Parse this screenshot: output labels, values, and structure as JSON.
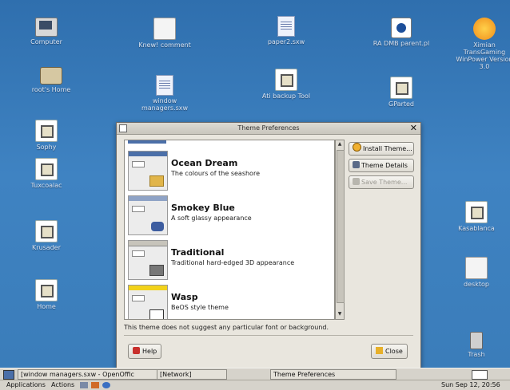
{
  "desktop": {
    "icons": [
      {
        "label": "Computer",
        "kind": "computer"
      },
      {
        "label": "root's Home",
        "kind": "folder"
      },
      {
        "label": "Knew! comment",
        "kind": "blank"
      },
      {
        "label": "window managers.sxw",
        "kind": "page"
      },
      {
        "label": "paper2.sxw",
        "kind": "page"
      },
      {
        "label": "Ati backup Tool",
        "kind": "doc"
      },
      {
        "label": "RA DMB parent.pl",
        "kind": "disc"
      },
      {
        "label": "GParted",
        "kind": "doc"
      },
      {
        "label": "Ximian TransGaming WinPower Version 3.0",
        "kind": "logo"
      },
      {
        "label": "Sophy",
        "kind": "doc"
      },
      {
        "label": "Tuxcoalac",
        "kind": "doc"
      },
      {
        "label": "Krusader",
        "kind": "doc"
      },
      {
        "label": "Home",
        "kind": "doc"
      },
      {
        "label": "Kasablanca",
        "kind": "doc"
      },
      {
        "label": "desktop",
        "kind": "blank"
      },
      {
        "label": "Trash",
        "kind": "trash"
      }
    ]
  },
  "dialog": {
    "title": "Theme Preferences",
    "close_glyph": "✕",
    "themes": [
      {
        "name": "Ocean Dream",
        "description": "The colours of the seashore",
        "bar_color": "#4b6fa8",
        "accent": "#e1b54a"
      },
      {
        "name": "Smokey Blue",
        "description": "A soft glassy appearance",
        "bar_color": "#8fa3c6",
        "accent": "#3d5da0"
      },
      {
        "name": "Traditional",
        "description": "Traditional hard-edged 3D appearance",
        "bar_color": "#c7c4bb",
        "accent": "#777777"
      },
      {
        "name": "Wasp",
        "description": "BeOS style theme",
        "bar_color": "#f2d21b",
        "accent": "#ffffff"
      }
    ],
    "buttons": {
      "install": "Install Theme...",
      "details": "Theme Details",
      "save": "Save Theme...",
      "help": "Help",
      "close": "Close"
    },
    "note": "This theme does not suggest any particular font or background."
  },
  "taskbar": {
    "tasks": [
      "[window managers.sxw - OpenOffic",
      "[Network]",
      "Theme Preferences"
    ]
  },
  "panel": {
    "applications": "Applications",
    "actions": "Actions",
    "clock": "Sun Sep 12, 20:56"
  }
}
